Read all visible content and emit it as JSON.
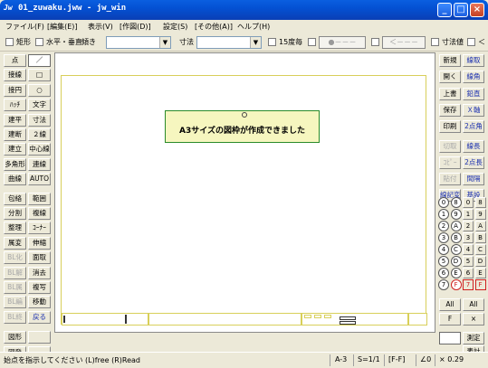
{
  "window": {
    "app_icon": "Jw",
    "title": "01_zuwaku.jww - jw_win",
    "minimize": "_",
    "maximize": "□",
    "close": "×"
  },
  "menu": [
    "ファイル(F)",
    "[編集(E)]",
    "表示(V)",
    "[作図(D)]",
    "設定(S)",
    "[その他(A)]",
    "ヘルプ(H)"
  ],
  "toolbar": {
    "rect_label": "矩形",
    "hv_label": "水平・垂直",
    "tilt_label": "傾き",
    "size_label": "寸法",
    "deg15_label": "15度毎",
    "btn1": "●－－－",
    "btn2": "＜－－－",
    "sizeval_label": "寸法値",
    "lt_label": "＜"
  },
  "left_palette": [
    [
      "点",
      "／"
    ],
    [
      "接線",
      "□"
    ],
    [
      "接円",
      "○"
    ],
    [
      "ﾊｯﾁ",
      "文字"
    ],
    [
      "建平",
      "寸法"
    ],
    [
      "建断",
      "２線"
    ],
    [
      "建立",
      "中心線"
    ],
    [
      "多角形",
      "連線"
    ],
    [
      "曲線",
      "AUTO"
    ],
    [
      "包絡",
      "範囲"
    ],
    [
      "分割",
      "複線"
    ],
    [
      "整理",
      "ｺｰﾅｰ"
    ],
    [
      "属変",
      "伸縮"
    ],
    [
      "BL化",
      "面取"
    ],
    [
      "BL解",
      "消去"
    ],
    [
      "BL属",
      "複写"
    ],
    [
      "BL編",
      "移動"
    ],
    [
      "BL終",
      "戻る"
    ],
    [
      "図形",
      ""
    ],
    [
      "図登",
      ""
    ]
  ],
  "right_palette": [
    [
      "新規",
      "線取"
    ],
    [
      "開く",
      "線角"
    ],
    [
      "上書",
      "鉛直"
    ],
    [
      "保存",
      "Ｘ軸"
    ],
    [
      "印刷",
      "2点角"
    ],
    [
      "切取",
      "線長"
    ],
    [
      "ｺﾋﾟｰ",
      "2点長"
    ],
    [
      "貼付",
      "間隔"
    ],
    [
      "線記変",
      "基設"
    ]
  ],
  "layer_grid": [
    [
      "0",
      "8",
      "0",
      "8"
    ],
    [
      "1",
      "9",
      "1",
      "9"
    ],
    [
      "2",
      "A",
      "2",
      "A"
    ],
    [
      "3",
      "B",
      "3",
      "B"
    ],
    [
      "4",
      "C",
      "4",
      "C"
    ],
    [
      "5",
      "D",
      "5",
      "D"
    ],
    [
      "6",
      "E",
      "6",
      "E"
    ],
    [
      "7",
      "F",
      "7",
      "F"
    ]
  ],
  "layer_bottom": {
    "all1": "All",
    "all2": "All",
    "f": "F",
    "x": "×",
    "measure": "測定",
    "extra": "表計"
  },
  "message": "A3サイズの図枠が作成できました",
  "status": {
    "hint": "始点を指示してください (L)free (R)Read",
    "paper": "A-3",
    "scale": "S=1/1",
    "layer": "[F-F]",
    "angle": "∠0",
    "zoom": "× 0.29"
  }
}
